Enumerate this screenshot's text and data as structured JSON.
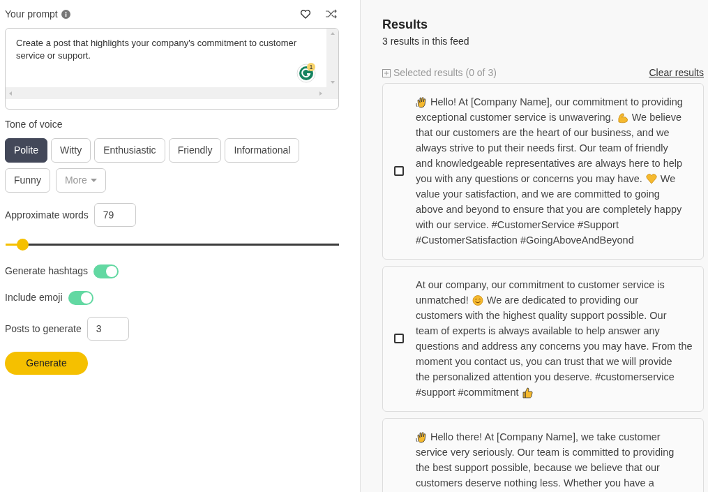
{
  "prompt": {
    "label": "Your prompt",
    "value": "Create a post that highlights your company's commitment to customer service or support.",
    "grammarly_count": "1"
  },
  "tone": {
    "label": "Tone of voice",
    "options": [
      {
        "label": "Polite",
        "selected": true
      },
      {
        "label": "Witty",
        "selected": false
      },
      {
        "label": "Enthusiastic",
        "selected": false
      },
      {
        "label": "Friendly",
        "selected": false
      },
      {
        "label": "Informational",
        "selected": false
      },
      {
        "label": "Funny",
        "selected": false
      }
    ],
    "more": "More"
  },
  "words": {
    "label": "Approximate words",
    "value": "79",
    "level": 0.05
  },
  "toggles": [
    {
      "label": "Generate hashtags",
      "on": true
    },
    {
      "label": "Include emoji",
      "on": true
    }
  ],
  "posts_count": {
    "label": "Posts to generate",
    "value": "3"
  },
  "generate": "Generate",
  "results": {
    "title": "Results",
    "subtitle": "3 results in this feed",
    "selected_label": "Selected results (0 of 3)",
    "clear": "Clear results",
    "posts": [
      {
        "checked": false,
        "lines": [
          [
            {
              "kind": "wave"
            },
            {
              "kind": "text",
              "text": "Hello! At [Company Name], our commitment to providing"
            }
          ],
          [
            {
              "kind": "text",
              "text": "exceptional customer service is unwavering."
            },
            {
              "kind": "arm"
            },
            {
              "kind": "text",
              "text": "We believe"
            }
          ],
          [
            {
              "kind": "text",
              "text": "that our customers are the heart of our business, and we"
            }
          ],
          [
            {
              "kind": "text",
              "text": "always strive to put their needs first. Our team of friendly"
            }
          ],
          [
            {
              "kind": "text",
              "text": "and knowledgeable representatives are always here to help"
            }
          ],
          [
            {
              "kind": "text",
              "text": "you with any questions or concerns you may have."
            },
            {
              "kind": "heart"
            },
            {
              "kind": "text",
              "text": "We"
            }
          ],
          [
            {
              "kind": "text",
              "text": "value your satisfaction, and we are committed to going"
            }
          ],
          [
            {
              "kind": "text",
              "text": "above and beyond to ensure that you are completely happy"
            }
          ],
          [
            {
              "kind": "text",
              "text": "with our service. #CustomerService #Support"
            }
          ],
          [
            {
              "kind": "text",
              "text": "#CustomerSatisfaction #GoingAboveAndBeyond"
            }
          ]
        ]
      },
      {
        "checked": false,
        "lines": [
          [
            {
              "kind": "text",
              "text": "At our company, our commitment to customer service is"
            }
          ],
          [
            {
              "kind": "text",
              "text": "unmatched!"
            },
            {
              "kind": "smile"
            },
            {
              "kind": "text",
              "text": "We are dedicated to providing our"
            }
          ],
          [
            {
              "kind": "text",
              "text": "customers with the highest quality support possible. Our"
            }
          ],
          [
            {
              "kind": "text",
              "text": "team of experts is always available to help answer any"
            }
          ],
          [
            {
              "kind": "text",
              "text": "questions and address any concerns you may have. From the"
            }
          ],
          [
            {
              "kind": "text",
              "text": "moment you contact us, you can trust that we will provide"
            }
          ],
          [
            {
              "kind": "text",
              "text": "the personalized attention you deserve. #customerservice"
            }
          ],
          [
            {
              "kind": "text",
              "text": "#support #commitment"
            },
            {
              "kind": "thumb"
            }
          ]
        ]
      },
      {
        "lines": [
          [
            {
              "kind": "wave"
            },
            {
              "kind": "text",
              "text": "Hello there! At [Company Name], we take customer"
            }
          ],
          [
            {
              "kind": "text",
              "text": "service very seriously. Our team is committed to providing"
            }
          ],
          [
            {
              "kind": "text",
              "text": "the best support possible, because we believe that our"
            }
          ],
          [
            {
              "kind": "text",
              "text": "customers deserve nothing less. Whether you have a"
            }
          ]
        ]
      }
    ]
  }
}
